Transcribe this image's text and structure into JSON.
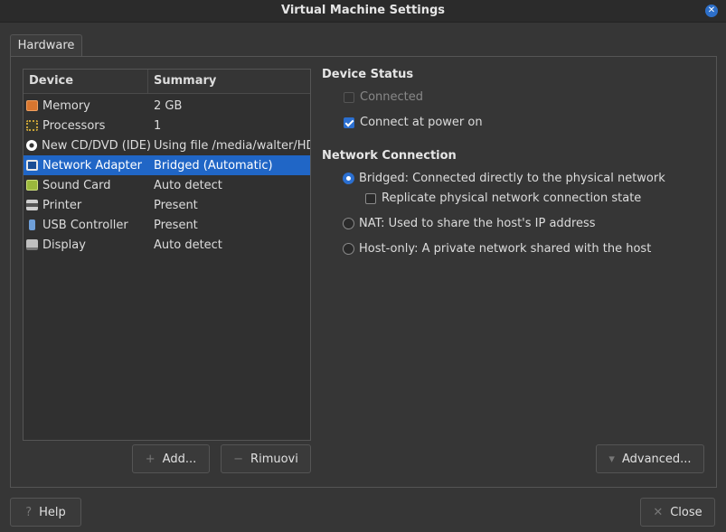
{
  "window": {
    "title": "Virtual Machine Settings",
    "close_glyph": "✕"
  },
  "tabs": [
    {
      "label": "Hardware",
      "selected": true
    }
  ],
  "device_table": {
    "headers": {
      "device": "Device",
      "summary": "Summary"
    },
    "rows": [
      {
        "device": "Memory",
        "summary": "2 GB",
        "icon": "memory-icon",
        "icon_color": "#d8762f"
      },
      {
        "device": "Processors",
        "summary": "1",
        "icon": "processor-icon",
        "icon_color": "#c9a23a"
      },
      {
        "device": "New CD/DVD (IDE)",
        "summary": "Using file /media/walter/HDD",
        "icon": "cd-dvd-icon",
        "icon_color": "#ffffff"
      },
      {
        "device": "Network Adapter",
        "summary": "Bridged (Automatic)",
        "icon": "network-adapter-icon",
        "icon_color": "#e0e0e0",
        "selected": true
      },
      {
        "device": "Sound Card",
        "summary": "Auto detect",
        "icon": "sound-card-icon",
        "icon_color": "#9bb83c"
      },
      {
        "device": "Printer",
        "summary": "Present",
        "icon": "printer-icon",
        "icon_color": "#cfcfcf"
      },
      {
        "device": "USB Controller",
        "summary": "Present",
        "icon": "usb-icon",
        "icon_color": "#6f9fd8"
      },
      {
        "device": "Display",
        "summary": "Auto detect",
        "icon": "display-icon",
        "icon_color": "#bfbfbf"
      }
    ]
  },
  "buttons": {
    "add": "Add...",
    "remove": "Rimuovi",
    "advanced": "Advanced...",
    "help": "Help",
    "close": "Close"
  },
  "device_status": {
    "title": "Device Status",
    "connected": {
      "label": "Connected",
      "checked": false,
      "enabled": false
    },
    "connect_at_power_on": {
      "label": "Connect at power on",
      "checked": true
    }
  },
  "network_connection": {
    "title": "Network Connection",
    "bridged": {
      "label": "Bridged: Connected directly to the physical network",
      "selected": true
    },
    "replicate": {
      "label": "Replicate physical network connection state",
      "checked": false
    },
    "nat": {
      "label": "NAT: Used to share the host's IP address",
      "selected": false
    },
    "host_only": {
      "label": "Host-only: A private network shared with the host",
      "selected": false
    }
  },
  "colors": {
    "accent": "#2066c6",
    "background": "#363636"
  }
}
